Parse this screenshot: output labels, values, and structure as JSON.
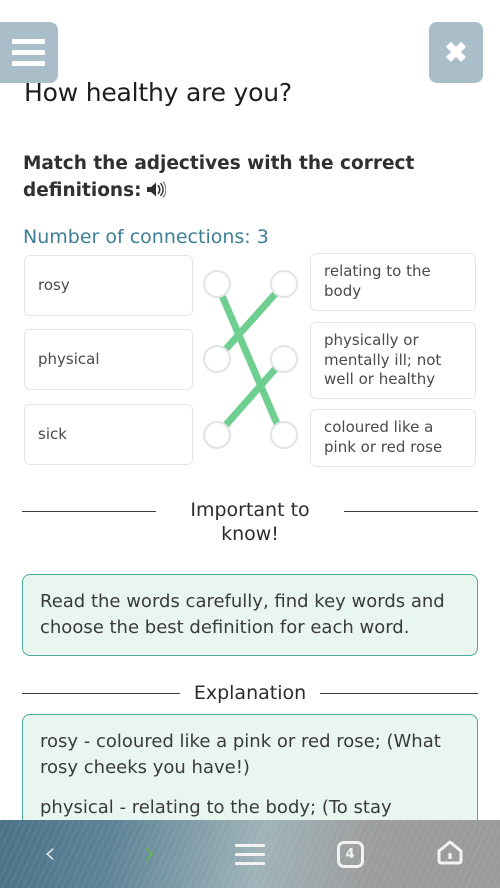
{
  "header": {
    "menu_icon": "hamburger-menu-icon",
    "close_icon": "close-x-icon",
    "title": "How healthy are you?"
  },
  "exercise": {
    "prompt": "Match the adjectives with the correct definitions:",
    "audio_icon": "speaker-sound-icon",
    "connections_label": "Number of connections: 3",
    "accent_color": "#3d7f95",
    "link_color": "#6ecf91",
    "left_items": [
      {
        "label": "rosy"
      },
      {
        "label": "physical"
      },
      {
        "label": "sick"
      }
    ],
    "right_items": [
      {
        "label": "relating to the body"
      },
      {
        "label": "physically or mentally ill; not well or healthy"
      },
      {
        "label": "coloured like a pink or red rose"
      }
    ],
    "connections": [
      {
        "from": 0,
        "to": 2
      },
      {
        "from": 1,
        "to": 0
      },
      {
        "from": 2,
        "to": 1
      }
    ]
  },
  "important": {
    "heading": "Important to know!",
    "body": "Read the words carefully, find key words and choose the best definition for each word."
  },
  "explanation": {
    "heading": "Explanation",
    "lines": [
      "rosy - coloured like a pink or red rose; (What rosy cheeks you have!)",
      "physical - relating to the body; (To stay"
    ]
  },
  "navbar": {
    "back_icon": "chevron-left-icon",
    "forward_icon": "chevron-right-icon",
    "menu_icon": "hamburger-menu-icon",
    "tabs_icon": "tab-count-icon",
    "tabs_count": "4",
    "home_icon": "home-icon"
  }
}
